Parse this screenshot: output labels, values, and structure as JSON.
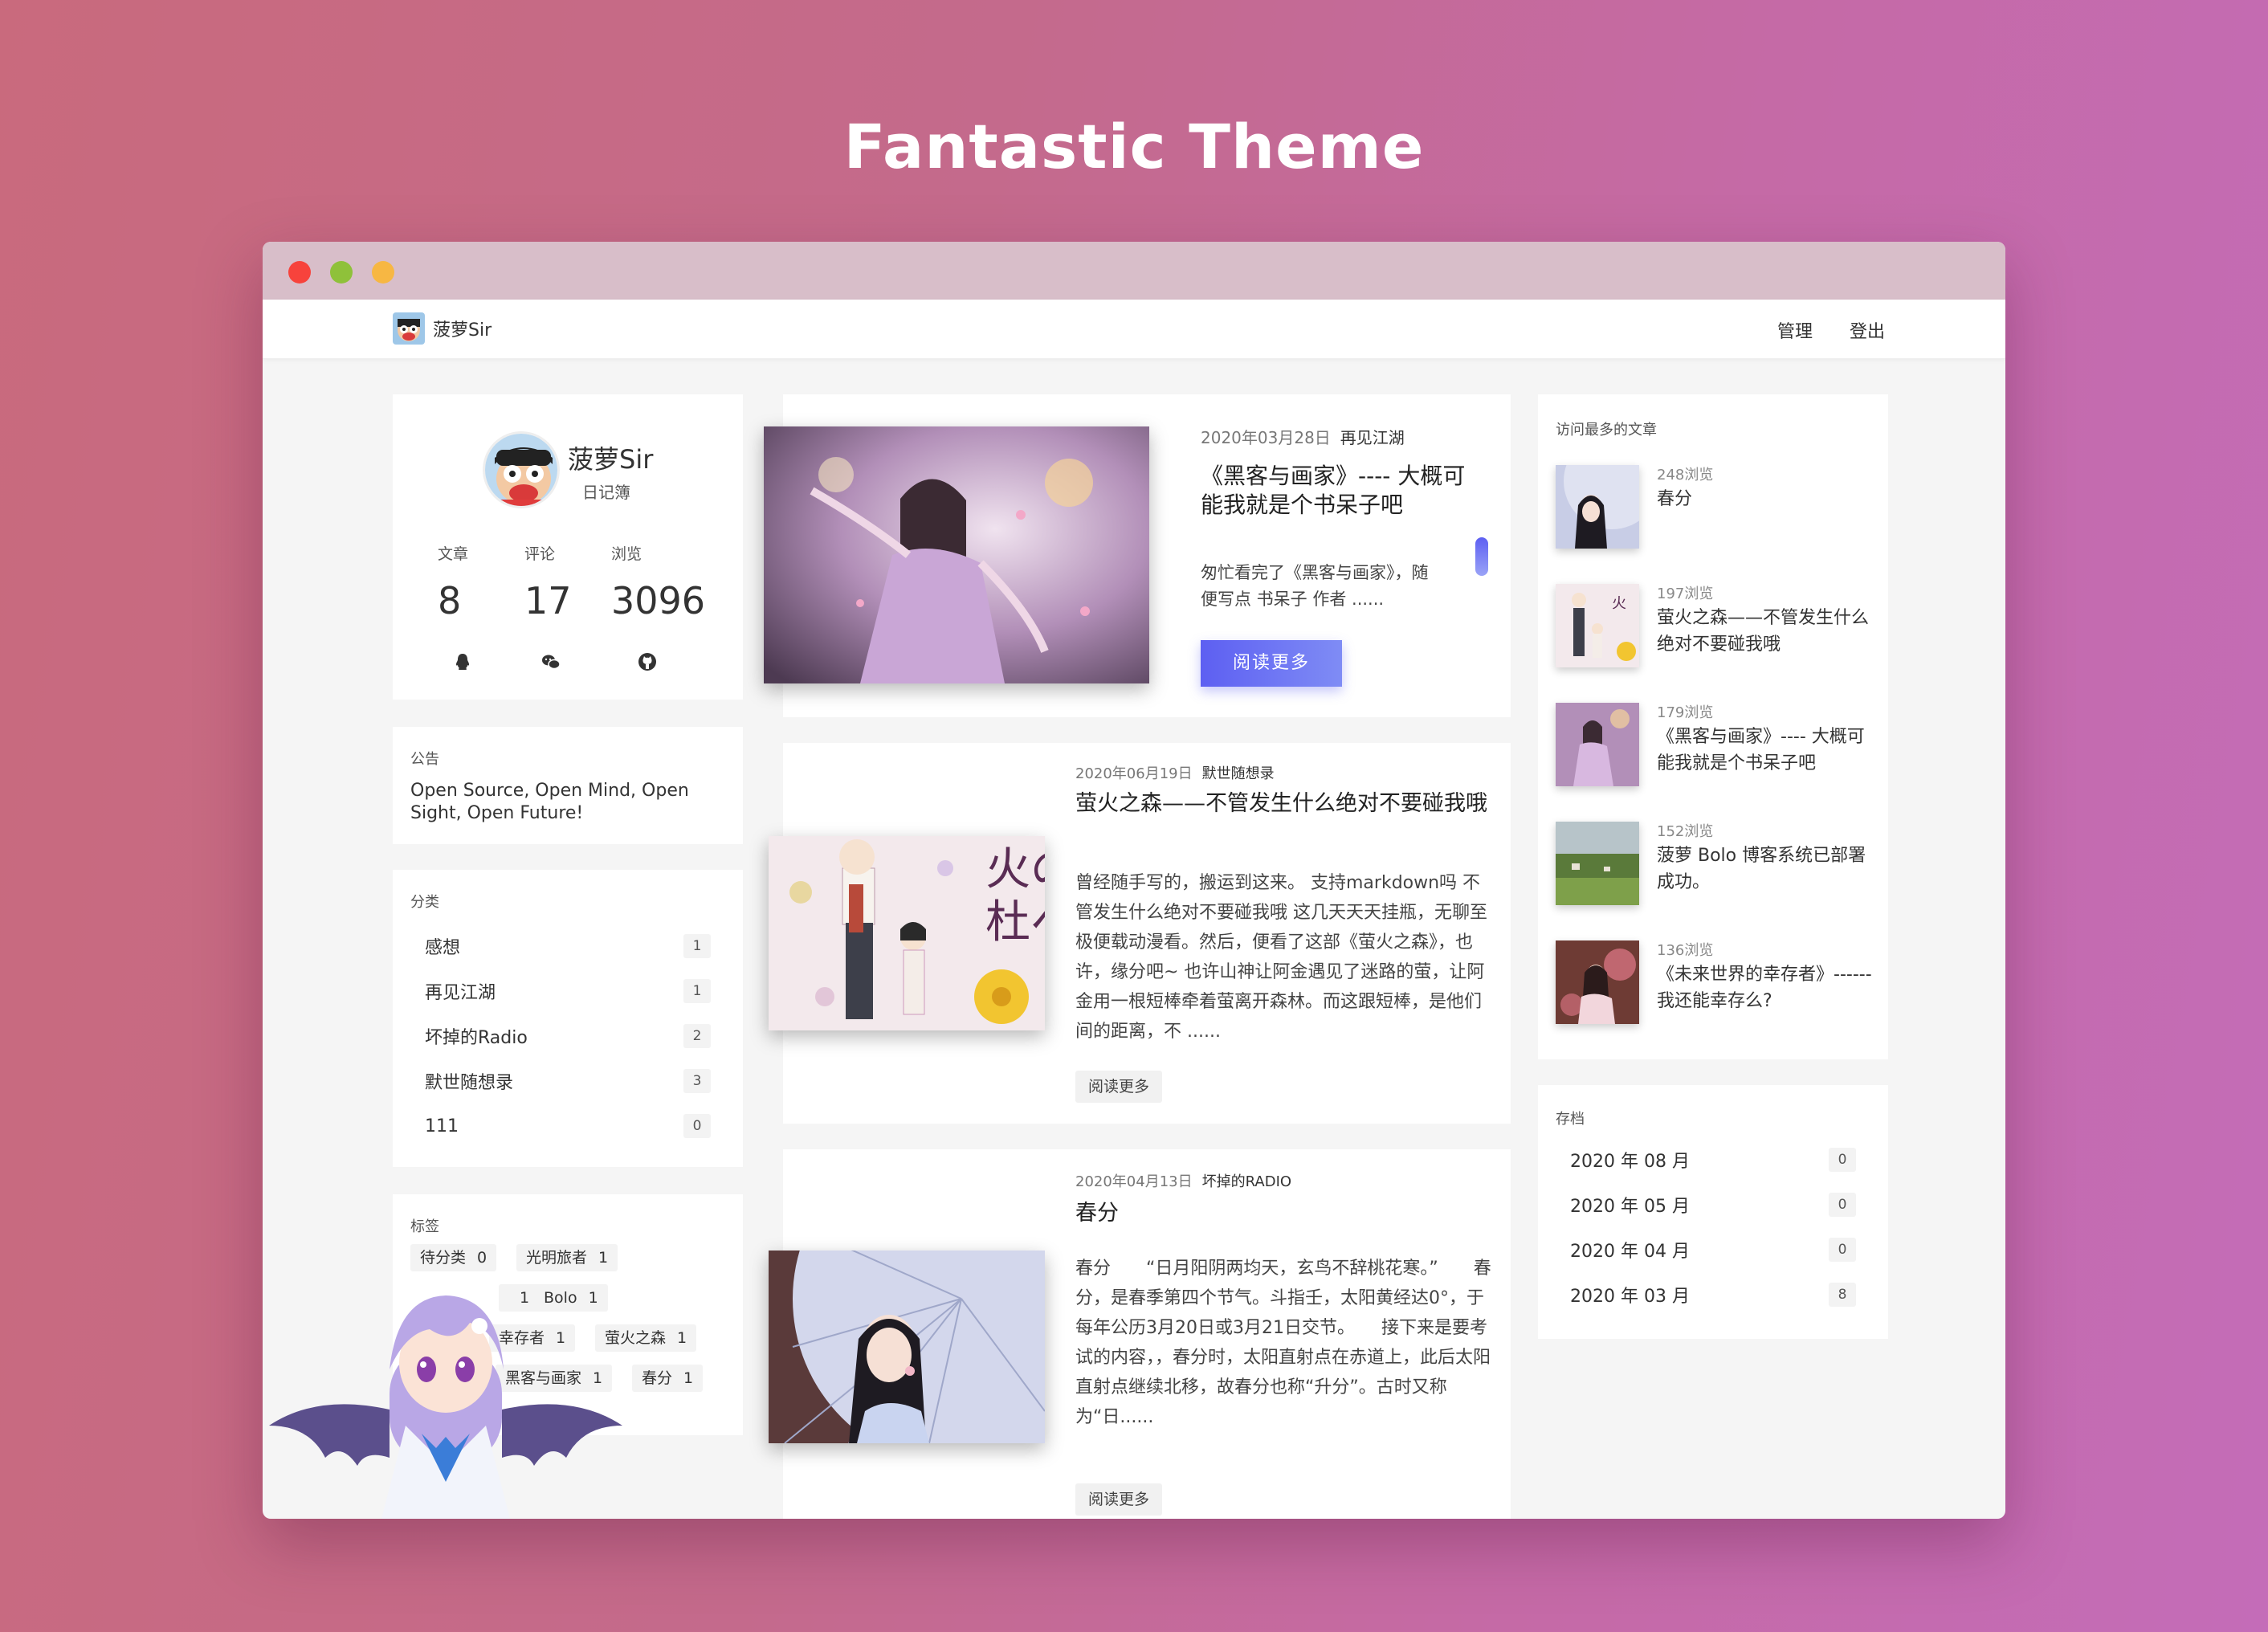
{
  "hero": {
    "title": "Fantastic Theme"
  },
  "nav": {
    "brand": "菠萝Sir",
    "links": [
      "管理",
      "登出"
    ]
  },
  "profile": {
    "name": "菠萝Sir",
    "subtitle": "日记簿",
    "stats": [
      {
        "label": "文章",
        "value": "8"
      },
      {
        "label": "评论",
        "value": "17"
      },
      {
        "label": "浏览",
        "value": "3096"
      }
    ],
    "social_icons": [
      "qq-icon",
      "wechat-icon",
      "github-icon"
    ]
  },
  "notice": {
    "title": "公告",
    "text": "Open Source, Open Mind, Open Sight, Open Future!"
  },
  "categories": {
    "title": "分类",
    "items": [
      {
        "name": "感想",
        "count": "1"
      },
      {
        "name": "再见江湖",
        "count": "1"
      },
      {
        "name": "坏掉的Radio",
        "count": "2"
      },
      {
        "name": "默世随想录",
        "count": "3"
      },
      {
        "name": "111",
        "count": "0"
      }
    ]
  },
  "tags": {
    "title": "标签",
    "items": [
      {
        "name": "待分类",
        "count": "0"
      },
      {
        "name": "光明旅者",
        "count": "1"
      },
      {
        "name": "",
        "count": "1"
      },
      {
        "name": "Bolo",
        "count": "1"
      },
      {
        "name": "幸存者",
        "count": "1"
      },
      {
        "name": "萤火之森",
        "count": "1"
      },
      {
        "name": "黑客与画家",
        "count": "1"
      },
      {
        "name": "春分",
        "count": "1"
      }
    ]
  },
  "posts": [
    {
      "date": "2020年03月28日",
      "category": "再见江湖",
      "title": "《黑客与画家》---- 大概可能我就是个书呆子吧",
      "excerpt": "匆忙看完了《黑客与画家》，随便写点 书呆子 作者 ......",
      "read_more": "阅读更多"
    },
    {
      "date": "2020年06月19日",
      "category": "默世随想录",
      "title": "萤火之森——不管发生什么绝对不要碰我哦",
      "excerpt": "曾经随手写的，搬运到这来。 支持markdown吗 不管发生什么绝对不要碰我哦 这几天天天挂瓶，无聊至极便载动漫看。然后，便看了这部《萤火之森》，也许，缘分吧~ 也许山神让阿金遇见了迷路的萤，让阿金用一根短棒牵着萤离开森林。而这跟短棒，是他们间的距离，不 ......",
      "read_more": "阅读更多"
    },
    {
      "date": "2020年04月13日",
      "category": "坏掉的RADIO",
      "title": "春分",
      "excerpt": "春分　　“日月阳阴两均天，玄鸟不辞桃花寒。”　　春分，是春季第四个节气。斗指壬，太阳黄经达0°，于每年公历3月20日或3月21日交节。　　接下来是要考试的内容，，春分时，太阳直射点在赤道上，此后太阳直射点继续北移，故春分也称“升分”。古时又称为“日......",
      "read_more": "阅读更多"
    }
  ],
  "popular": {
    "title": "访问最多的文章",
    "items": [
      {
        "views": "248浏览",
        "title": "春分"
      },
      {
        "views": "197浏览",
        "title": "萤火之森——不管发生什么绝对不要碰我哦"
      },
      {
        "views": "179浏览",
        "title": "《黑客与画家》---- 大概可能我就是个书呆子吧"
      },
      {
        "views": "152浏览",
        "title": "菠萝 Bolo 博客系统已部署成功。"
      },
      {
        "views": "136浏览",
        "title": "《未来世界的幸存者》------我还能幸存么?"
      }
    ]
  },
  "archive": {
    "title": "存档",
    "items": [
      {
        "month": "2020 年 08 月",
        "count": "0"
      },
      {
        "month": "2020 年 05 月",
        "count": "0"
      },
      {
        "month": "2020 年 04 月",
        "count": "0"
      },
      {
        "month": "2020 年 03 月",
        "count": "8"
      }
    ]
  },
  "colors": {
    "accent": "#5d5ff2",
    "titlebar": "#d8bec9"
  }
}
